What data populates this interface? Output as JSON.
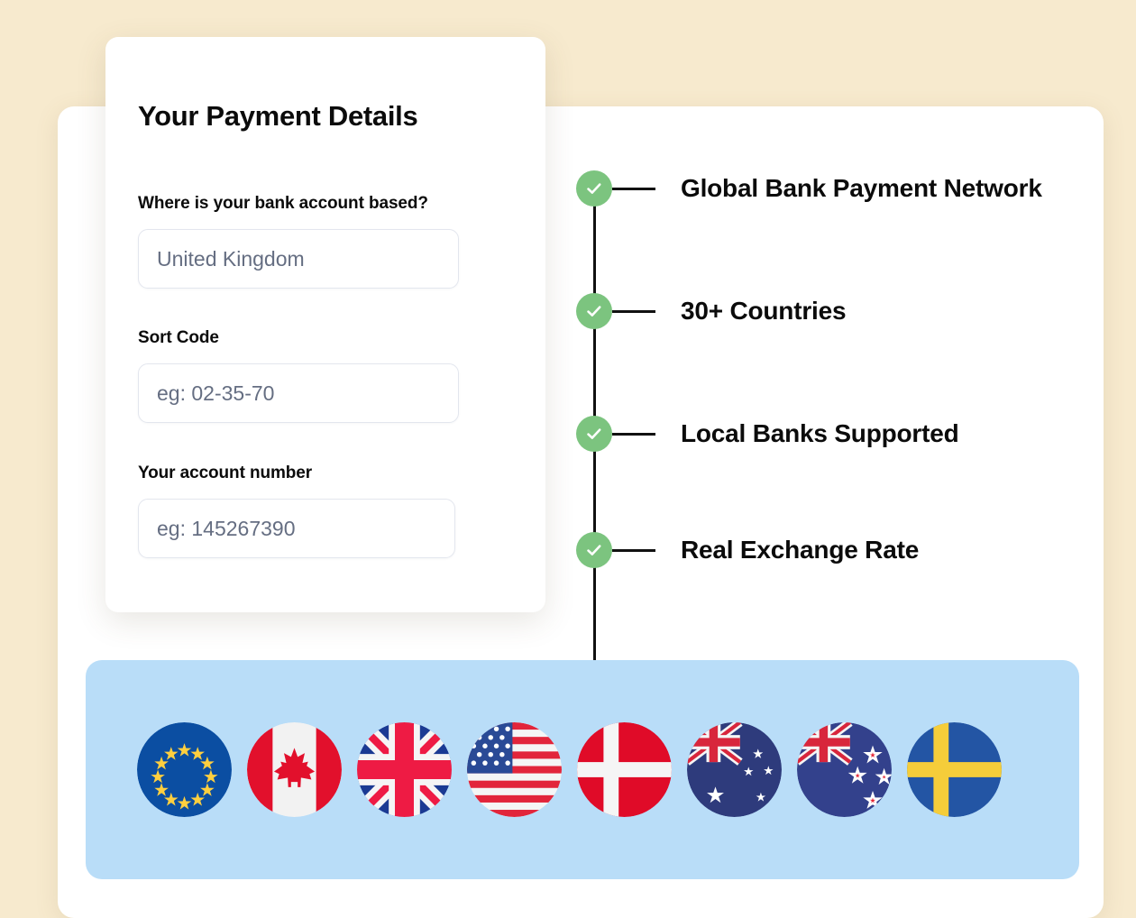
{
  "form": {
    "title": "Your Payment Details",
    "fields": [
      {
        "label": "Where is your bank account based?",
        "placeholder": "United Kingdom",
        "value": ""
      },
      {
        "label": "Sort Code",
        "placeholder": "eg: 02-35-70",
        "value": ""
      },
      {
        "label": "Your account number",
        "placeholder": "eg: 145267390",
        "value": ""
      }
    ]
  },
  "checklist": {
    "items": [
      {
        "label": "Global Bank Payment Network",
        "icon": "check-icon",
        "checked": true
      },
      {
        "label": "30+ Countries",
        "icon": "check-icon",
        "checked": true
      },
      {
        "label": "Local Banks Supported",
        "icon": "check-icon",
        "checked": true
      },
      {
        "label": "Real Exchange Rate",
        "icon": "check-icon",
        "checked": true
      }
    ]
  },
  "flags": {
    "items": [
      {
        "name": "European Union",
        "code": "EU"
      },
      {
        "name": "Canada",
        "code": "CA"
      },
      {
        "name": "United Kingdom",
        "code": "GB"
      },
      {
        "name": "United States",
        "code": "US"
      },
      {
        "name": "Denmark",
        "code": "DK"
      },
      {
        "name": "Australia",
        "code": "AU"
      },
      {
        "name": "New Zealand",
        "code": "NZ"
      },
      {
        "name": "Sweden",
        "code": "SE"
      }
    ]
  },
  "colors": {
    "page_background": "#f7eace",
    "card_background": "#ffffff",
    "flag_band": "#b9ddf8",
    "check_green": "#7cc47f",
    "spine": "#111111",
    "input_border": "#e3e6ee",
    "placeholder_text": "#656e82",
    "heading_text": "#0b0b0b"
  }
}
